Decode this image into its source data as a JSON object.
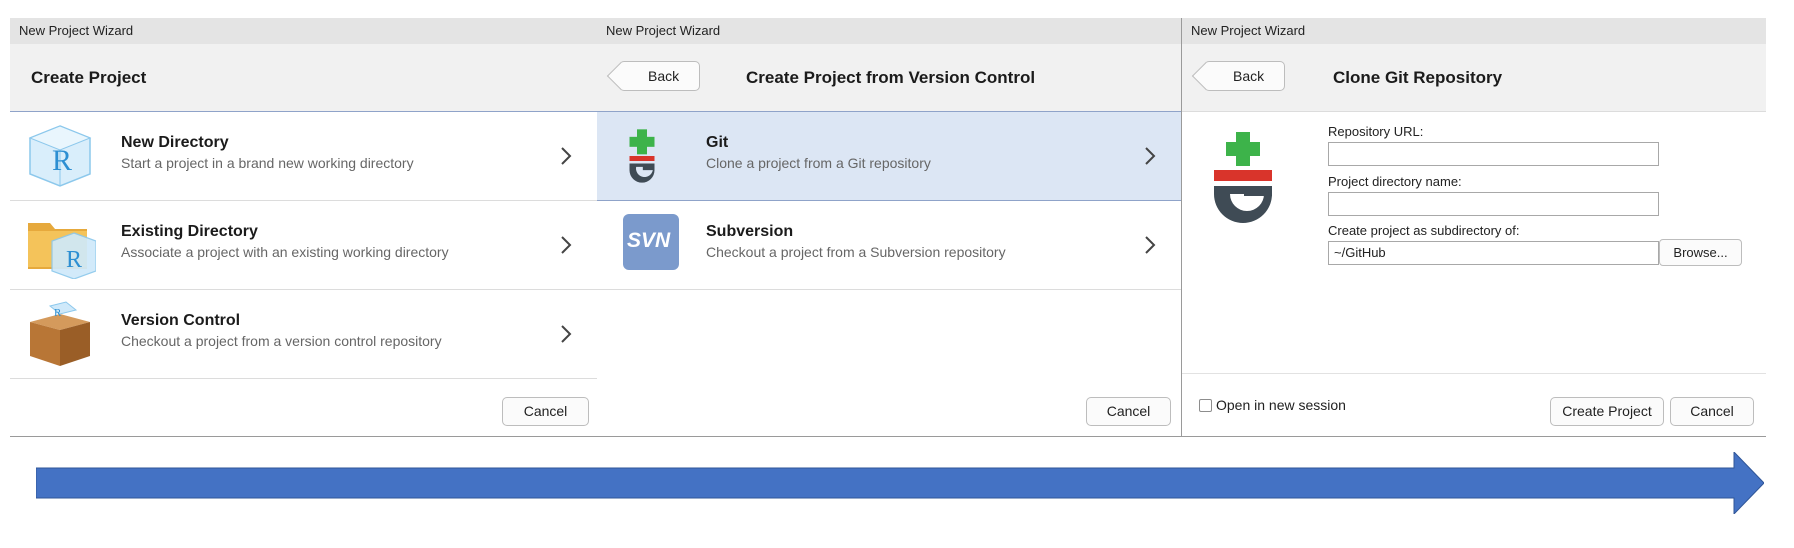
{
  "panel1": {
    "window_title": "New Project Wizard",
    "header_title": "Create Project",
    "options": [
      {
        "title": "New Directory",
        "desc": "Start a project in a brand new working directory",
        "icon": "r-cube-icon"
      },
      {
        "title": "Existing Directory",
        "desc": "Associate a project with an existing working directory",
        "icon": "folder-r-icon"
      },
      {
        "title": "Version Control",
        "desc": "Checkout a project from a version control repository",
        "icon": "box-icon"
      }
    ],
    "cancel_label": "Cancel"
  },
  "panel2": {
    "window_title": "New Project Wizard",
    "back_label": "Back",
    "header_title": "Create Project from Version Control",
    "options": [
      {
        "title": "Git",
        "desc": "Clone a project from a Git repository",
        "icon": "git-icon",
        "selected": true
      },
      {
        "title": "Subversion",
        "desc": "Checkout a project from a Subversion repository",
        "icon": "svn-icon",
        "icon_text": "SVN"
      }
    ],
    "cancel_label": "Cancel"
  },
  "panel3": {
    "window_title": "New Project Wizard",
    "back_label": "Back",
    "header_title": "Clone Git Repository",
    "repo_url_label": "Repository URL:",
    "repo_url_value": "",
    "dir_name_label": "Project directory name:",
    "dir_name_value": "",
    "subdir_label": "Create project as subdirectory of:",
    "subdir_value": "~/GitHub",
    "browse_label": "Browse...",
    "open_new_session_label": "Open in new session",
    "open_new_session_checked": false,
    "create_label": "Create Project",
    "cancel_label": "Cancel"
  },
  "colors": {
    "selected_row": "#dce6f4",
    "arrow": "#4472c4",
    "git_green": "#3db34a",
    "git_red": "#d9342b",
    "git_gray": "#3f4b55",
    "svn_blue": "#7b9acc"
  }
}
